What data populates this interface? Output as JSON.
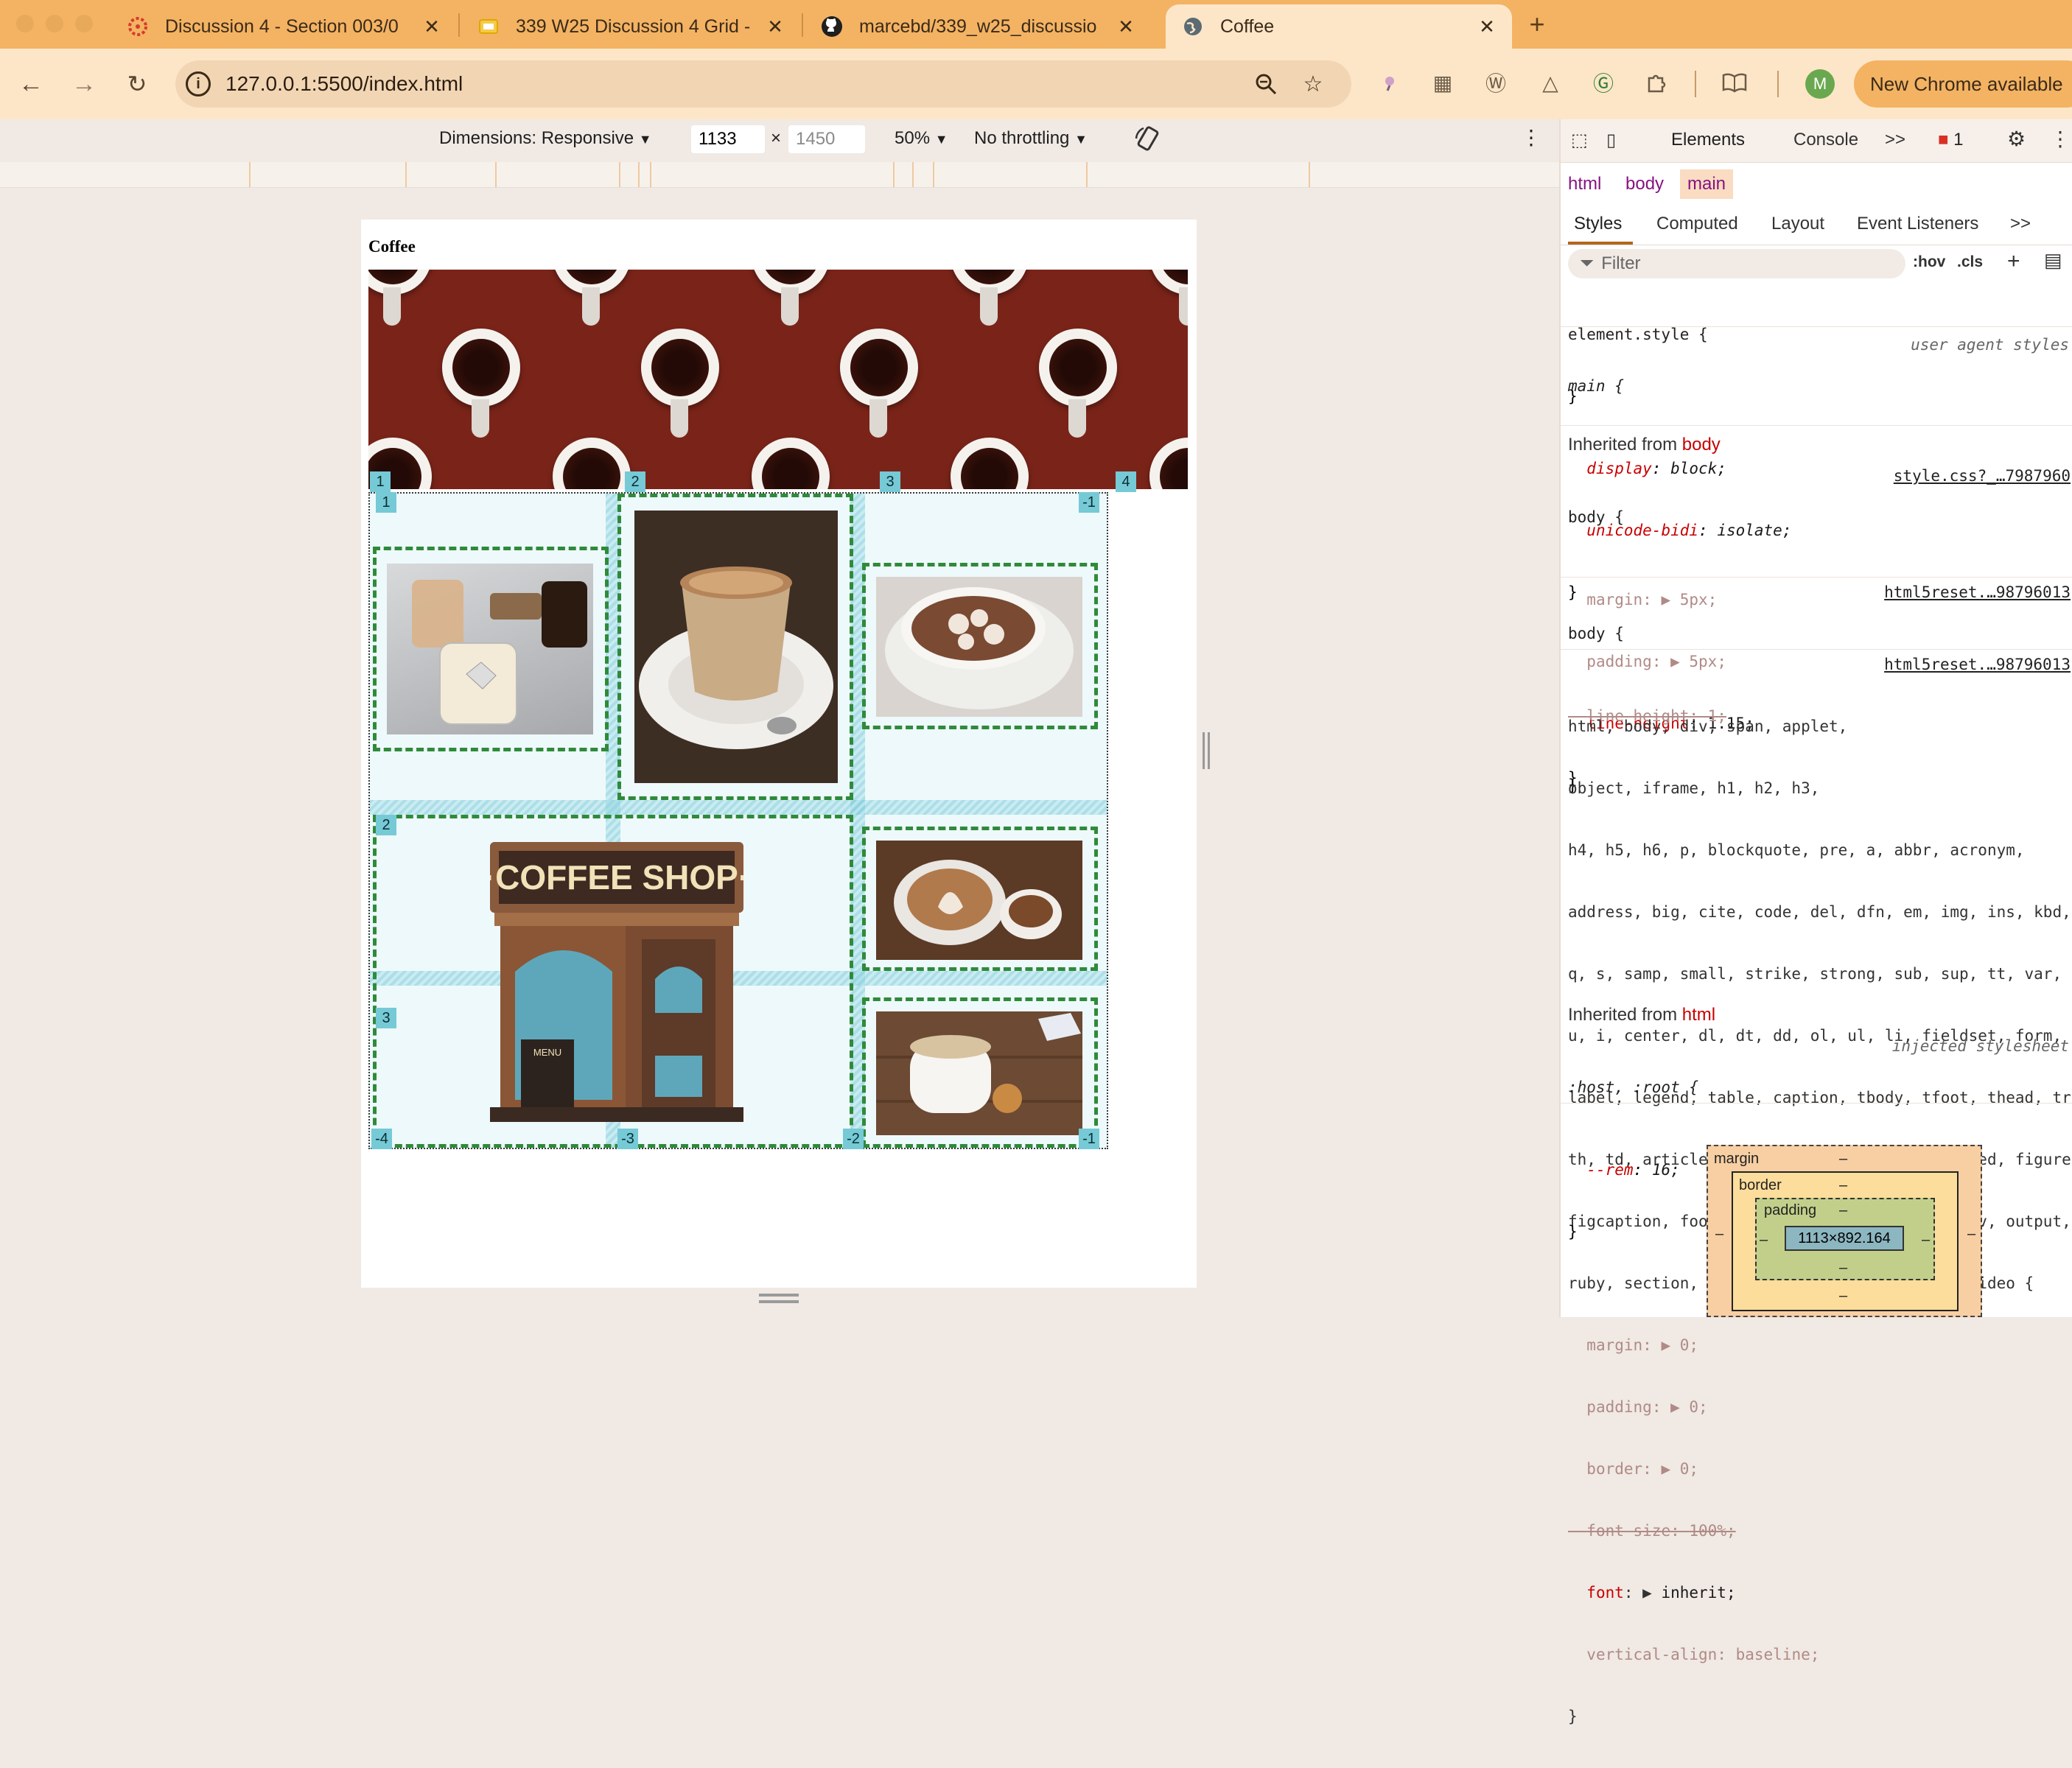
{
  "browser": {
    "tabs": [
      {
        "title": "Discussion 4 - Section 003/0",
        "favicon": "canvas-icon",
        "active": false
      },
      {
        "title": "339 W25 Discussion 4 Grid -",
        "favicon": "slides-icon",
        "active": false
      },
      {
        "title": "marcebd/339_w25_discussio",
        "favicon": "github-icon",
        "active": false
      },
      {
        "title": "Coffee",
        "favicon": "globe-icon",
        "active": true
      }
    ],
    "new_tab": "+",
    "close_glyph": "✕",
    "url": "127.0.0.1:5500/index.html",
    "avatar_letter": "M",
    "update_button": "New Chrome available",
    "colors": {
      "tabstrip": "#f3b363",
      "toolbar": "#fde6c8"
    }
  },
  "device_toolbar": {
    "dimensions_label": "Dimensions: Responsive",
    "width": "1133",
    "times": "×",
    "height_placeholder": "1450",
    "zoom": "50%",
    "throttling": "No throttling"
  },
  "page": {
    "title": "Coffee",
    "grid_line_labels": {
      "top_cols": [
        "1",
        "2",
        "3",
        "4"
      ],
      "top_right": "-1",
      "row_labels": [
        "1",
        "2",
        "3"
      ],
      "bottom": [
        "-4",
        "-3",
        "-2",
        "-1"
      ]
    },
    "images": [
      "milk-tea-glasses-photo",
      "cappuccino-glass-photo",
      "hot-chocolate-marshmallow-photo",
      "coffee-shop-illustration",
      "latte-art-photo",
      "milk-tea-cookie-photo"
    ],
    "shop_sign": "·COFFEE SHOP·",
    "menu_board": "MENU",
    "colors": {
      "banner": "#7a2419",
      "grid_overlay": "#eef9fb",
      "item_border": "#2f8a3a",
      "label": "#75cad6"
    }
  },
  "devtools": {
    "tabs": [
      "Elements",
      "Console"
    ],
    "active_tab": "Elements",
    "more_tabs": ">>",
    "issues_count": "1",
    "breadcrumbs": [
      "html",
      "body",
      "main"
    ],
    "style_tabs": [
      "Styles",
      "Computed",
      "Layout",
      "Event Listeners"
    ],
    "filter_placeholder": "Filter",
    "hov": ":hov",
    "cls": ".cls",
    "rules": {
      "element_style": "element.style {",
      "main_sel": "main {",
      "main_src": "user agent styles",
      "main_props": [
        [
          "display",
          "block;"
        ],
        [
          "unicode-bidi",
          "isolate;"
        ]
      ],
      "inherited_body": "Inherited from",
      "inherited_body_tag": "body",
      "body1_sel": "body {",
      "body1_src": "style.css?_…7987960",
      "body1_props": [
        [
          "margin",
          "5px;"
        ],
        [
          "padding",
          "5px;"
        ],
        [
          "line-height",
          "1.15;"
        ]
      ],
      "body2_sel": "body {",
      "body2_src": "html5reset.…98796013",
      "body2_prop": "line-height: 1;",
      "reset_src": "html5reset.…98796013",
      "reset_selector_lines": [
        "html, body, div, span, applet,",
        "object, iframe, h1, h2, h3,",
        "h4, h5, h6, p, blockquote, pre, a, abbr, acronym,",
        "address, big, cite, code, del, dfn, em, img, ins, kbd,",
        "q, s, samp, small, strike, strong, sub, sup, tt, var,",
        "u, i, center, dl, dt, dd, ol, ul, li, fieldset, form,",
        "label, legend, table, caption, tbody, tfoot, thead, tr,",
        "th, td, article, aside, canvas, details, embed, figure,",
        "figcaption, footer, header, hgroup, menu, nav, output,",
        "ruby, section, summary, time, mark, audio, video {"
      ],
      "reset_props": [
        [
          "margin",
          "0;"
        ],
        [
          "padding",
          "0;"
        ],
        [
          "border",
          "0;"
        ],
        [
          "font-size",
          "100%;"
        ],
        [
          "font",
          "inherit;"
        ],
        [
          "vertical-align",
          "baseline;"
        ]
      ],
      "inherited_html": "Inherited from",
      "inherited_html_tag": "html",
      "root_sel": ":host, :root {",
      "root_src": "injected stylesheet",
      "root_prop": [
        "--rem",
        "16;"
      ],
      "close": "}"
    },
    "box_model": {
      "margin": "margin",
      "border": "border",
      "padding": "padding",
      "content": "1113×892.164",
      "dash": "–"
    }
  }
}
